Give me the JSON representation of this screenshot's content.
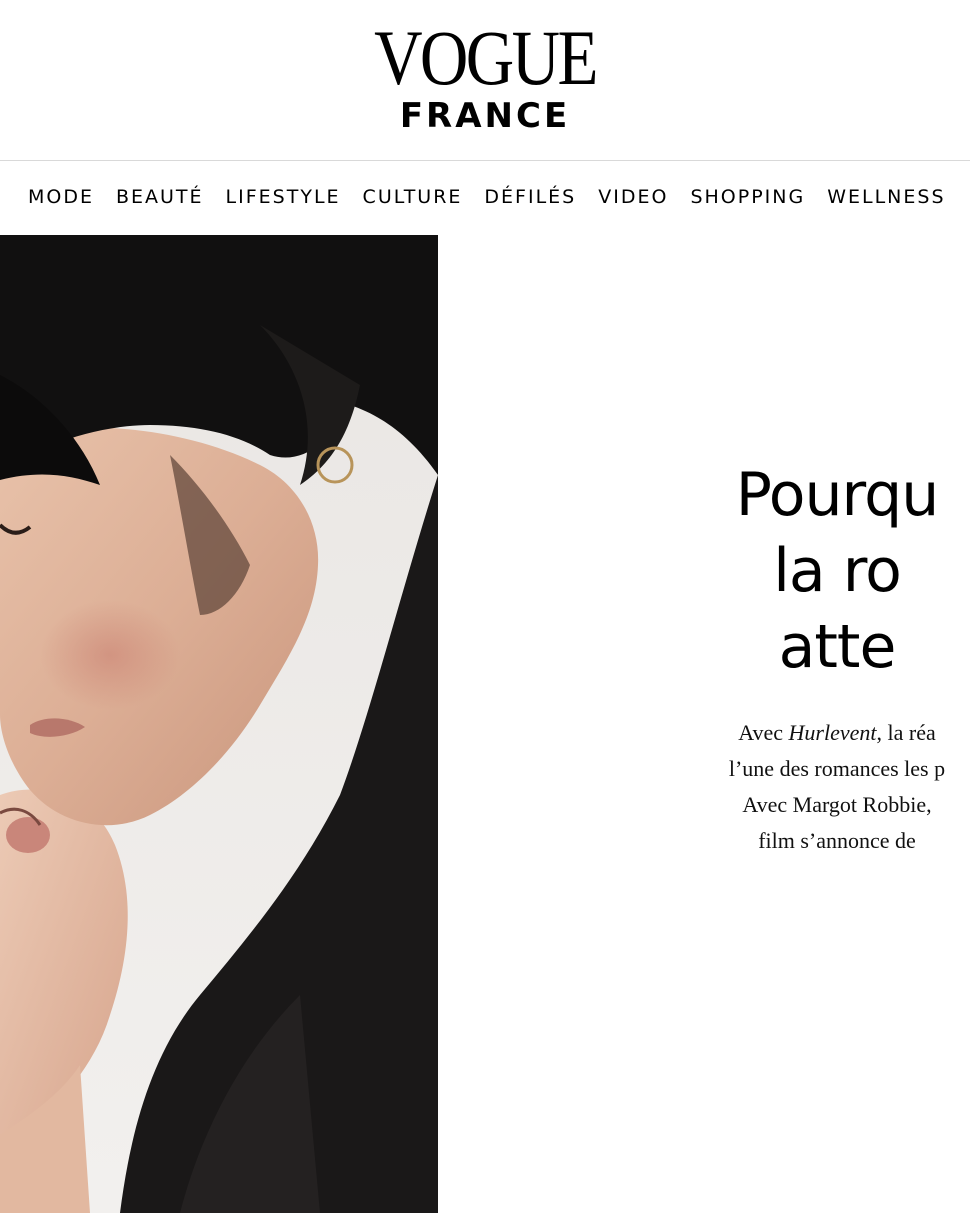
{
  "header": {
    "logo_main": "VOGUE",
    "logo_sub": "FRANCE"
  },
  "nav": {
    "items": [
      "MODE",
      "BEAUTÉ",
      "LIFESTYLE",
      "CULTURE",
      "DÉFILÉS",
      "VIDEO",
      "SHOPPING",
      "WELLNESS"
    ]
  },
  "article": {
    "headline_lines": [
      "Pourqu",
      "la ro",
      "atte"
    ],
    "dek_line1_a": "Avec ",
    "dek_line1_em": "Hurlevent",
    "dek_line1_b": ", la réa",
    "dek_line2": "l’une des romances les p",
    "dek_line3": "Avec Margot Robbie,",
    "dek_line4": "film s’annonce de"
  },
  "hero_image": {
    "description_icon": "photo-couple-kiss"
  }
}
